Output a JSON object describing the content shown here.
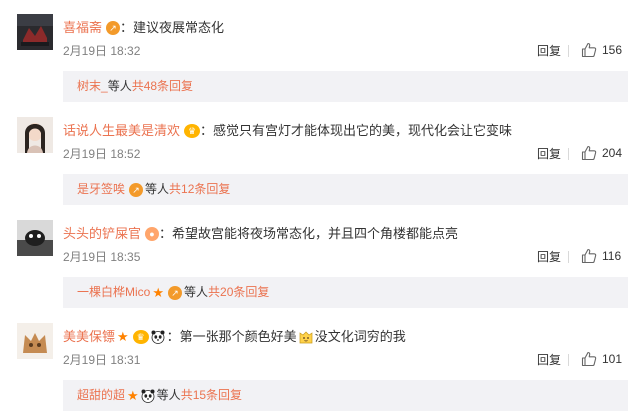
{
  "comments": [
    {
      "user": "喜福斋",
      "badge": "orange",
      "text": "：建议夜展常态化",
      "date": "2月19日 18:32",
      "reply": "回复",
      "likes": "156",
      "sub": {
        "name": "树末_",
        "middle": " 等人 ",
        "count": "共48条回复"
      }
    },
    {
      "user": "话说人生最美是清欢",
      "badge": "crown",
      "text": "：感觉只有宫灯才能体现出它的美，现代化会让它变味",
      "date": "2月19日 18:52",
      "reply": "回复",
      "likes": "204",
      "sub": {
        "name": "是牙签唉",
        "middle": " 等人 ",
        "count": "共12条回复"
      }
    },
    {
      "user": "头头的铲屎官",
      "badge": "peach",
      "text": "：希望故宫能将夜场常态化，并且四个角楼都能点亮",
      "date": "2月19日 18:35",
      "reply": "回复",
      "likes": "116",
      "sub": {
        "name": "一棵白桦Mico",
        "middle": " 等人 ",
        "count": "共20条回复"
      }
    },
    {
      "user": "美美保镖",
      "badge": "star-crown-panda",
      "text_a": "：第一张那个颜色好美",
      "text_b": "没文化词穷的我",
      "date": "2月19日 18:31",
      "reply": "回复",
      "likes": "101",
      "sub": {
        "name": "超甜的超",
        "middle": " 等人 ",
        "count": "共15条回复"
      }
    }
  ],
  "colors": {
    "link": "#eb7350",
    "subbg": "#f2f2f5",
    "date": "#808080"
  },
  "icons": [
    "thumbs-up-icon",
    "vip-badge-icon",
    "star-icon",
    "panda-icon",
    "cat-emoji-icon"
  ]
}
